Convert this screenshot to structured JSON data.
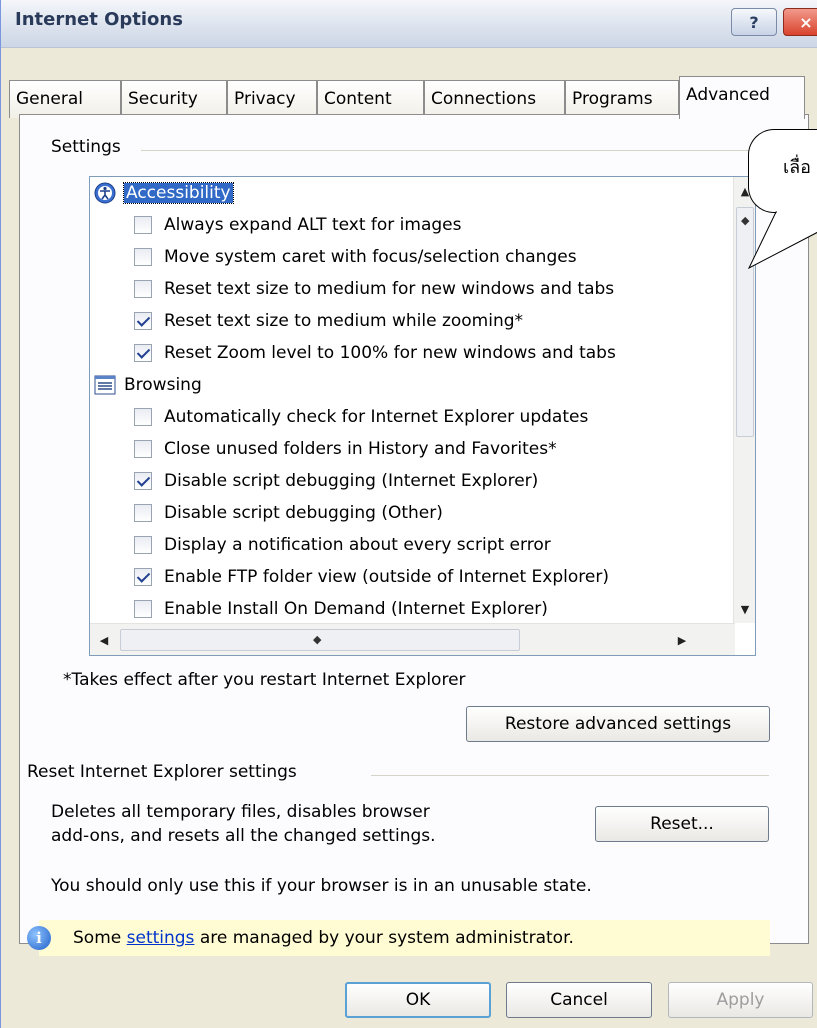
{
  "window": {
    "title": "Internet Options"
  },
  "title_buttons": {
    "help": "?",
    "close": "×"
  },
  "tabs": [
    {
      "label": "General"
    },
    {
      "label": "Security"
    },
    {
      "label": "Privacy"
    },
    {
      "label": "Content"
    },
    {
      "label": "Connections"
    },
    {
      "label": "Programs"
    },
    {
      "label": "Advanced",
      "active": true
    }
  ],
  "settings": {
    "group_label": "Settings",
    "categories": [
      {
        "label": "Accessibility",
        "icon": "accessibility-icon",
        "selected": true,
        "items": [
          {
            "label": "Always expand ALT text for images",
            "checked": false
          },
          {
            "label": "Move system caret with focus/selection changes",
            "checked": false
          },
          {
            "label": "Reset text size to medium for new windows and tabs",
            "checked": false
          },
          {
            "label": "Reset text size to medium while zooming*",
            "checked": true
          },
          {
            "label": "Reset Zoom level to 100% for new windows and tabs",
            "checked": true
          }
        ]
      },
      {
        "label": "Browsing",
        "icon": "browsing-icon",
        "selected": false,
        "items": [
          {
            "label": "Automatically check for Internet Explorer updates",
            "checked": false
          },
          {
            "label": "Close unused folders in History and Favorites*",
            "checked": false
          },
          {
            "label": "Disable script debugging (Internet Explorer)",
            "checked": true
          },
          {
            "label": "Disable script debugging (Other)",
            "checked": false
          },
          {
            "label": "Display a notification about every script error",
            "checked": false
          },
          {
            "label": "Enable FTP folder view (outside of Internet Explorer)",
            "checked": true
          },
          {
            "label": "Enable Install On Demand (Internet Explorer)",
            "checked": false
          }
        ]
      }
    ],
    "restart_note": "*Takes effect after you restart Internet Explorer",
    "restore_button": "Restore advanced settings"
  },
  "reset": {
    "group_label": "Reset Internet Explorer settings",
    "description_line1": "Deletes all temporary files, disables browser",
    "description_line2": "add-ons, and resets all the changed settings.",
    "reset_button": "Reset...",
    "warning": "You should only use this if your browser is in an unusable state."
  },
  "info": {
    "prefix": "Some ",
    "link": "settings",
    "suffix": " are managed by your system administrator."
  },
  "footer": {
    "ok": "OK",
    "cancel": "Cancel",
    "apply": "Apply"
  },
  "callout": {
    "text": "เลื่อ"
  },
  "colors": {
    "selection": "#3169c6",
    "info_bg": "#fffbd3",
    "link": "#0033cc"
  }
}
